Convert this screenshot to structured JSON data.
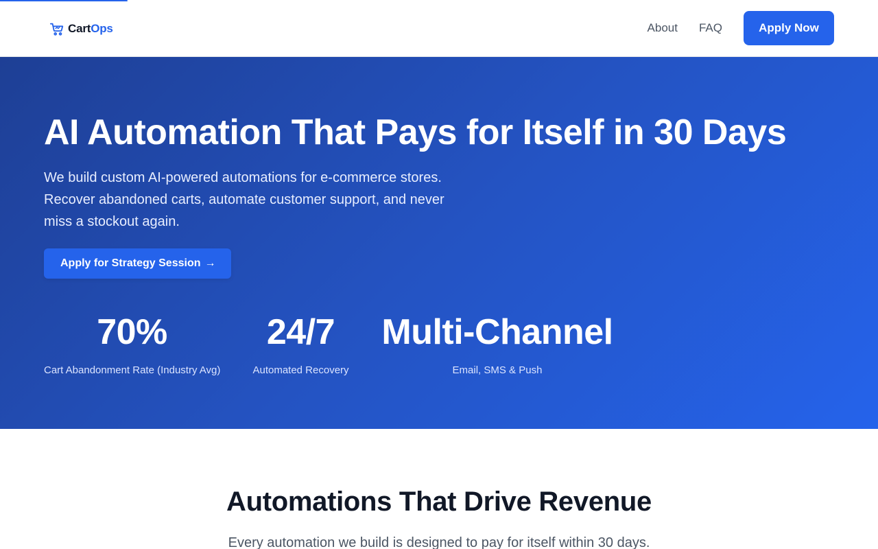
{
  "header": {
    "logo": {
      "icon": "shopping-cart-icon",
      "part1": "Cart",
      "part2": "Ops"
    },
    "nav": {
      "about": "About",
      "faq": "FAQ",
      "cta": "Apply Now"
    }
  },
  "hero": {
    "title": "AI Automation That Pays for Itself in 30 Days",
    "subtitle": "We build custom AI-powered automations for e-commerce stores. Recover abandoned carts, automate customer support, and never miss a stockout again.",
    "cta": {
      "label": "Apply for Strategy Session",
      "arrow": "→"
    },
    "stats": [
      {
        "value": "70%",
        "label": "Cart Abandonment Rate (Industry Avg)"
      },
      {
        "value": "24/7",
        "label": "Automated Recovery"
      },
      {
        "value": "Multi-Channel",
        "label": "Email, SMS & Push"
      }
    ]
  },
  "features": {
    "title": "Automations That Drive Revenue",
    "subtitle": "Every automation we build is designed to pay for itself within 30 days."
  },
  "colors": {
    "accent": "#2563eb",
    "hero_gradient_start": "#1e3f95",
    "hero_gradient_end": "#2563eb",
    "text_dark": "#111827",
    "text_muted": "#4b5563"
  }
}
